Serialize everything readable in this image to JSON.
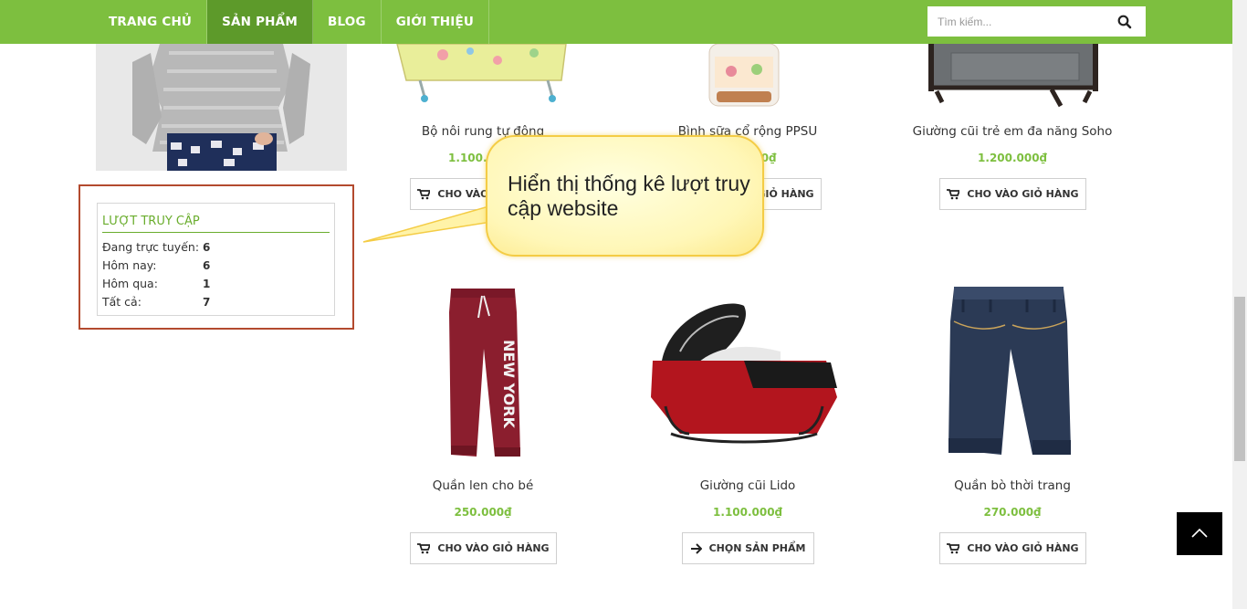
{
  "nav": {
    "items": [
      {
        "label": "TRANG CHỦ"
      },
      {
        "label": "SẢN PHẨM",
        "active": true
      },
      {
        "label": "BLOG"
      },
      {
        "label": "GIỚI THIỆU"
      }
    ]
  },
  "search": {
    "placeholder": "Tìm kiếm...",
    "icon": "search-icon"
  },
  "counter": {
    "title": "LƯỢT TRUY CẬP",
    "rows": [
      {
        "label": "Đang trực tuyến:",
        "value": "6"
      },
      {
        "label": "Hôm nay:",
        "value": "6"
      },
      {
        "label": "Hôm qua:",
        "value": "1"
      },
      {
        "label": "Tất cả:",
        "value": "7"
      }
    ]
  },
  "callout": {
    "text": "Hiển thị thống kê lượt truy cập website"
  },
  "products": [
    {
      "name": "Bộ nôi rung tự động",
      "price": "1.100.000₫",
      "button": "CHO VÀO GIỎ HÀNG",
      "button_icon": "cart-icon"
    },
    {
      "name": "Bình sữa cổ rộng PPSU",
      "price": "450.000₫",
      "button": "CHO VÀO GIỎ HÀNG",
      "button_icon": "cart-icon"
    },
    {
      "name": "Giường cũi trẻ em đa năng Soho",
      "price": "1.200.000₫",
      "button": "CHO VÀO GIỎ HÀNG",
      "button_icon": "cart-icon"
    },
    {
      "name": "Quần len cho bé",
      "price": "250.000₫",
      "button": "CHO VÀO GIỎ HÀNG",
      "button_icon": "cart-icon"
    },
    {
      "name": "Giường cũi Lido",
      "price": "1.100.000₫",
      "button": "CHỌN SẢN PHẨM",
      "button_icon": "arrow-right-icon"
    },
    {
      "name": "Quần bò thời trang",
      "price": "270.000₫",
      "button": "CHO VÀO GIỎ HÀNG",
      "button_icon": "cart-icon"
    }
  ],
  "colors": {
    "brand_green": "#7dbf3f",
    "active_nav": "#5d9a2a",
    "highlight_border": "#b34a2e"
  }
}
